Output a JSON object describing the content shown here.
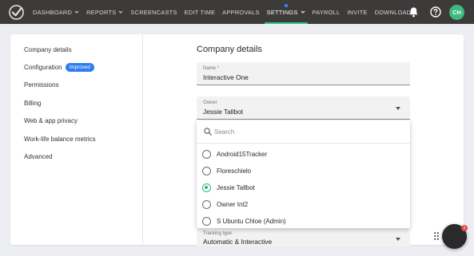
{
  "nav": {
    "items": [
      {
        "label": "DASHBOARD",
        "has_chevron": true
      },
      {
        "label": "REPORTS",
        "has_chevron": true
      },
      {
        "label": "SCREENCASTS",
        "has_chevron": false
      },
      {
        "label": "EDIT TIME",
        "has_chevron": false
      },
      {
        "label": "APPROVALS",
        "has_chevron": false
      },
      {
        "label": "SETTINGS",
        "has_chevron": true
      },
      {
        "label": "PAYROLL",
        "has_chevron": false
      },
      {
        "label": "INVITE",
        "has_chevron": false
      },
      {
        "label": "DOWNLOAD",
        "has_chevron": false
      }
    ],
    "active": "SETTINGS",
    "avatar_initials": "CH",
    "accent_color": "#33c38a"
  },
  "sidebar": {
    "items": [
      {
        "label": "Company details"
      },
      {
        "label": "Configuration",
        "badge": "Improved"
      },
      {
        "label": "Permissions"
      },
      {
        "label": "Billing"
      },
      {
        "label": "Web & app privacy"
      },
      {
        "label": "Work-life balance metrics"
      },
      {
        "label": "Advanced"
      }
    ]
  },
  "main": {
    "title": "Company details",
    "name_field": {
      "label": "Name *",
      "value": "Interactive One"
    },
    "owner_field": {
      "label": "Owner",
      "value": "Jessie Tallbot"
    },
    "tracking_field": {
      "label": "Tracking type",
      "value": "Automatic & Interactive"
    }
  },
  "dropdown": {
    "search_placeholder": "Search",
    "options": [
      "Android15Tracker",
      "Floreschielo",
      "Jessie Tallbot",
      "Owner Int2",
      "S Ubuntu Chloe (Admin)"
    ],
    "selected_index": 2
  },
  "chat": {
    "unread_count": "1"
  }
}
